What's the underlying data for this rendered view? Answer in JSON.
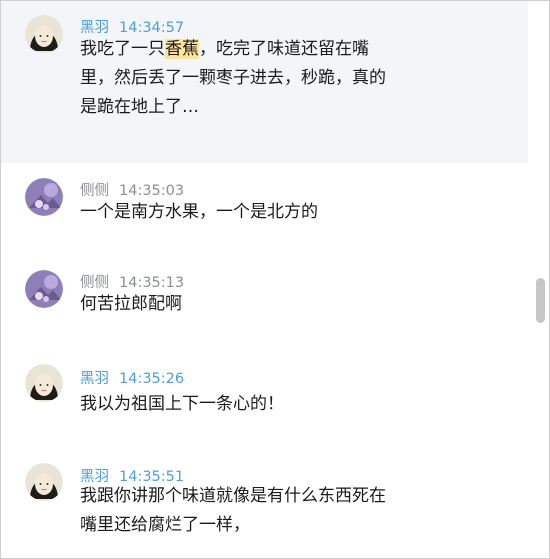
{
  "messages": [
    {
      "sender": "黑羽",
      "time": "14:34:57",
      "lines": [
        {
          "pre": "我吃了一只",
          "hl": "香蕉",
          "post": "，吃完了味道还留在嘴"
        },
        {
          "pre": "里，然后丢了一颗枣子进去，秒跪，真的",
          "hl": "",
          "post": ""
        },
        {
          "pre": "是跪在地上了…",
          "hl": "",
          "post": ""
        }
      ]
    },
    {
      "sender": "侧侧",
      "time": "14:35:03",
      "lines": [
        {
          "pre": "一个是南方水果，一个是北方的",
          "hl": "",
          "post": ""
        }
      ]
    },
    {
      "sender": "侧侧",
      "time": "14:35:13",
      "lines": [
        {
          "pre": "何苦拉郎配啊",
          "hl": "",
          "post": ""
        }
      ]
    },
    {
      "sender": "黑羽",
      "time": "14:35:26",
      "lines": [
        {
          "pre": "我以为祖国上下一条心的！",
          "hl": "",
          "post": ""
        }
      ]
    },
    {
      "sender": "黑羽",
      "time": "14:35:51",
      "lines": [
        {
          "pre": "我跟你讲那个味道就像是有什么东西死在",
          "hl": "",
          "post": ""
        },
        {
          "pre": "嘴里还给腐烂了一样，",
          "hl": "",
          "post": ""
        }
      ]
    }
  ],
  "colors": {
    "name_blue": "#4d9ee0",
    "name_gray": "#8b8f98",
    "highlight": "#fde49a",
    "selected_bg": "#f4f5f9"
  }
}
